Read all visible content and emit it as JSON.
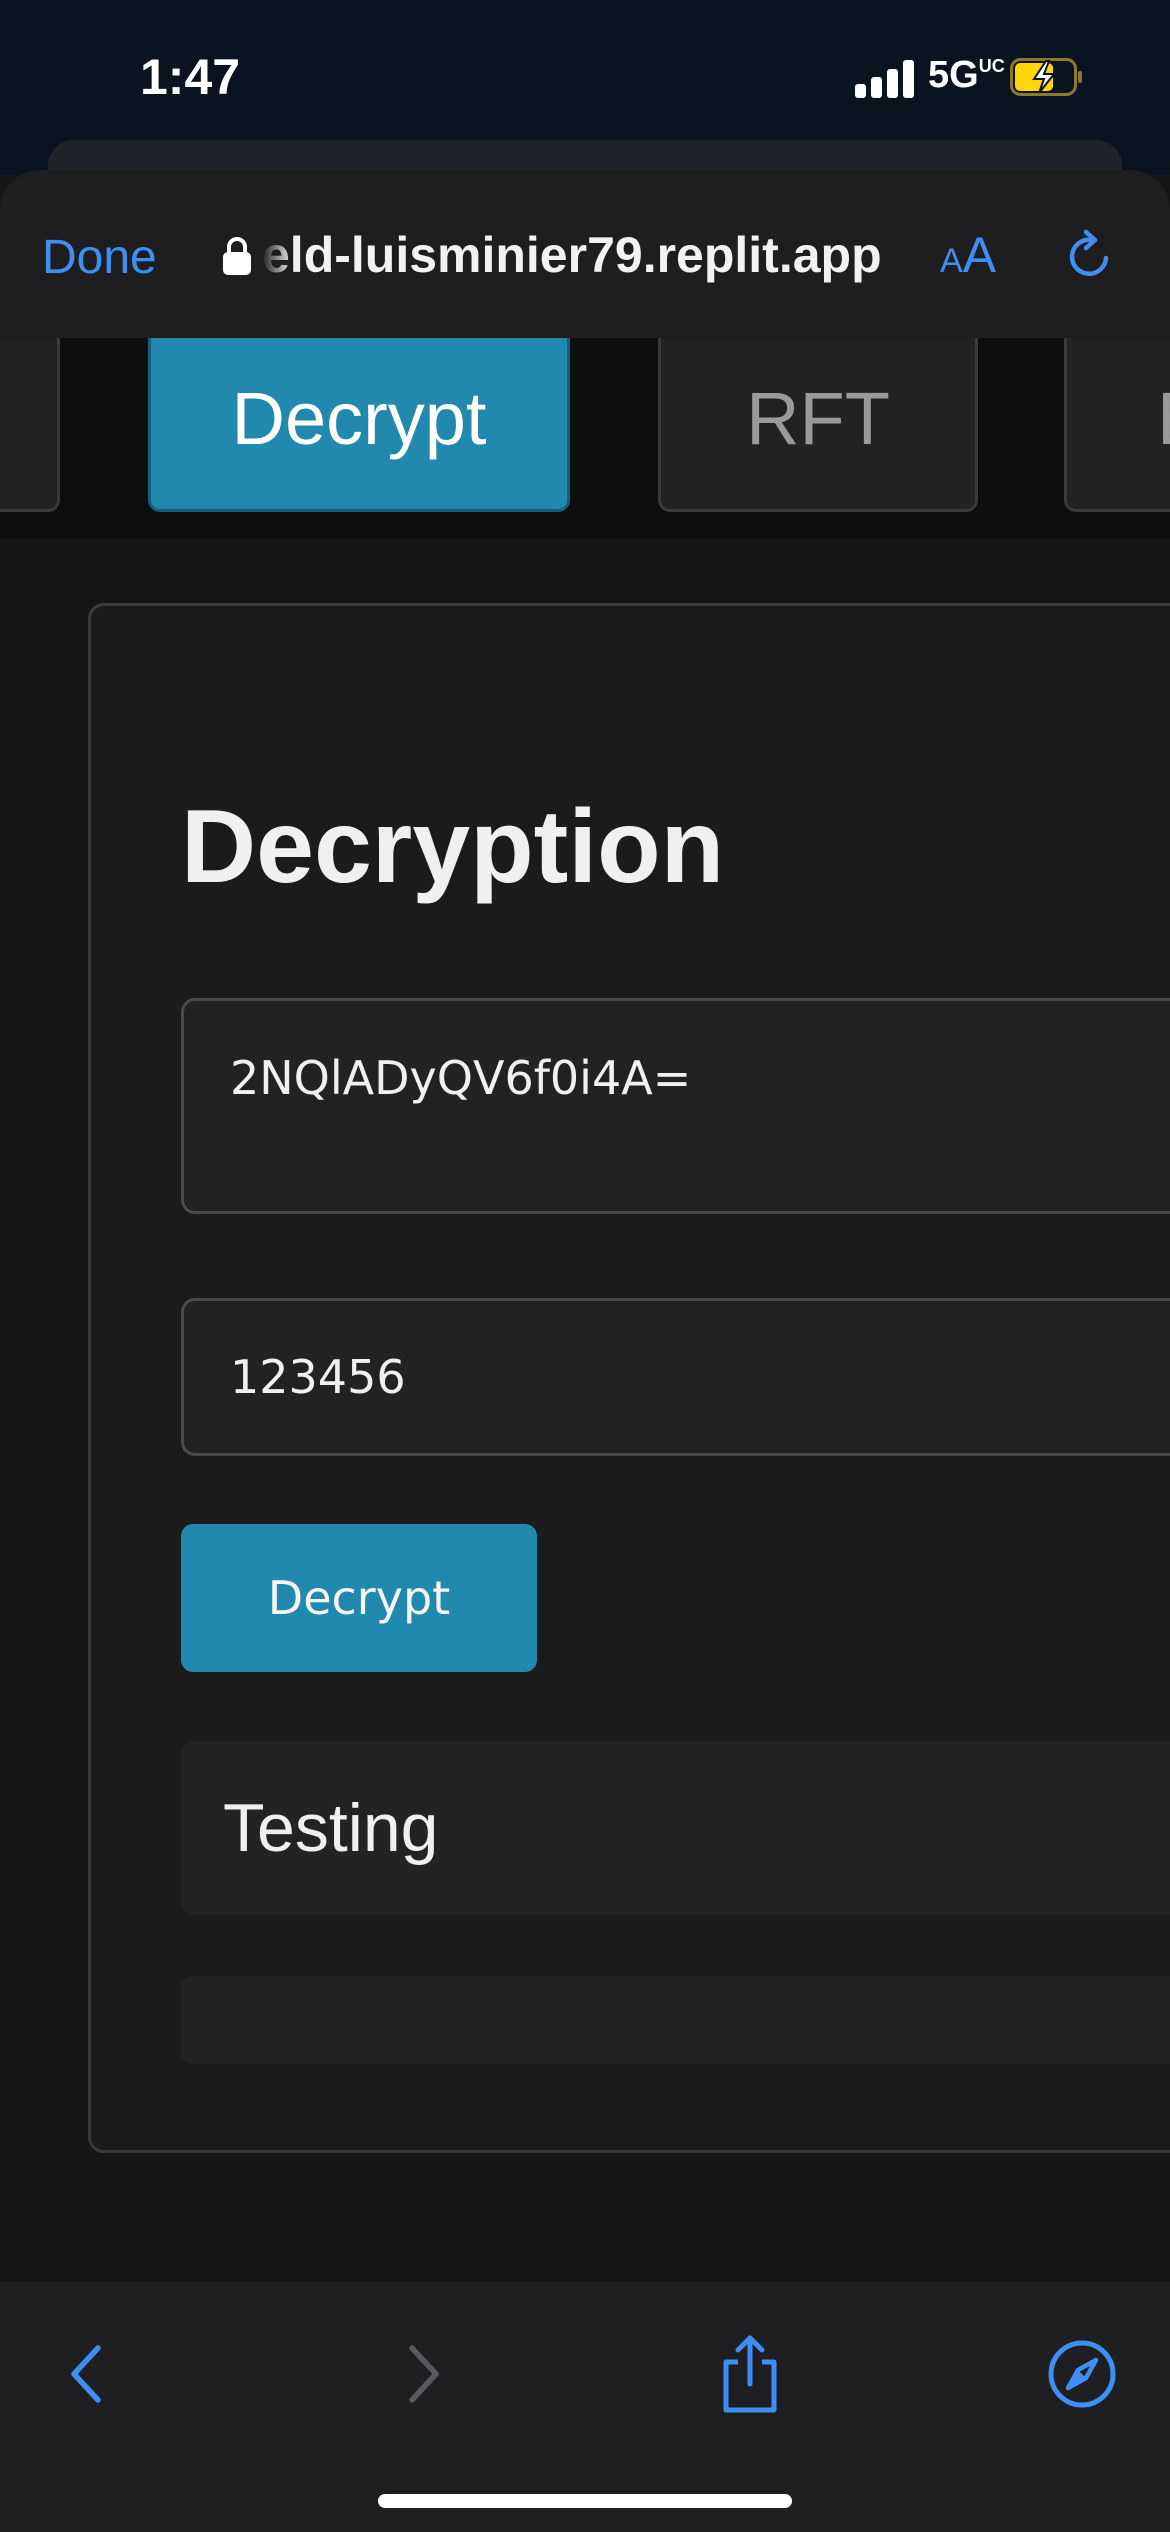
{
  "status_bar": {
    "time": "1:47",
    "network": "5G",
    "network_suffix": "UC",
    "battery_state": "charging",
    "battery_color": "#ffd60a"
  },
  "browser": {
    "done_label": "Done",
    "url": "eld-luisminier79.replit.app",
    "text_size_label_small": "A",
    "text_size_label_large": "A",
    "accent_color": "#3d8ff4"
  },
  "nav_tabs": [
    {
      "label": "",
      "active": false
    },
    {
      "label": "Decrypt",
      "active": true
    },
    {
      "label": "RFT",
      "active": false
    },
    {
      "label": "E",
      "active": false
    }
  ],
  "decryption": {
    "title": "Decryption",
    "ciphertext_value": "2NQlADyQV6f0i4A=",
    "password_value": "123456",
    "decrypt_button_label": "Decrypt",
    "output_text": "Testing",
    "accent_color": "#2189ad"
  },
  "bottom_toolbar": {
    "icons": [
      "back-arrow-icon",
      "forward-arrow-icon",
      "share-icon",
      "compass-icon"
    ]
  }
}
